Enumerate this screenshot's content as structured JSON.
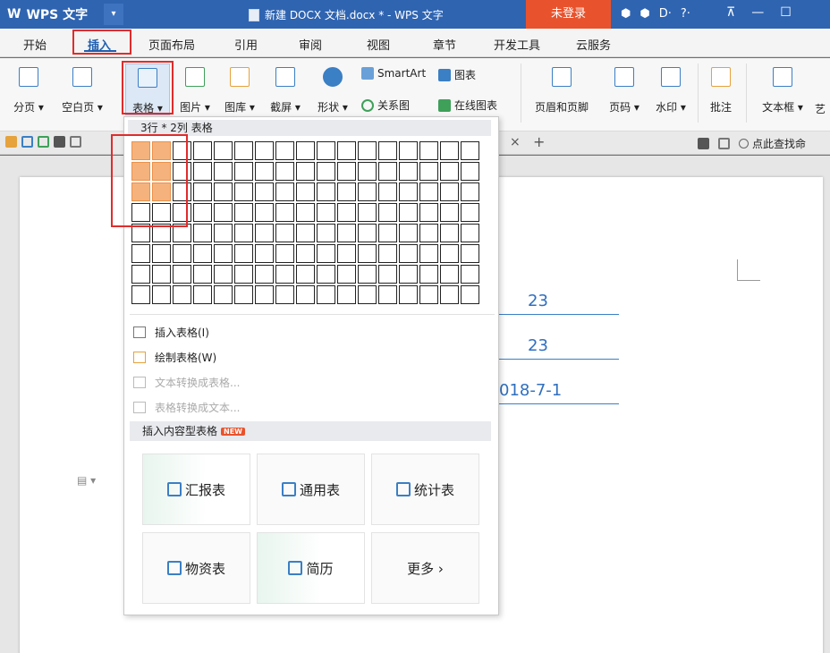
{
  "titlebar": {
    "app_logo": "W",
    "app_name": "WPS 文字",
    "app_arrow": "▾",
    "doc_title": "新建 DOCX 文档.docx * - WPS 文字",
    "login": "未登录",
    "tools": [
      "⬢",
      "⬢",
      "D·",
      "?·"
    ],
    "window_controls": [
      "⊼",
      "—",
      "☐"
    ]
  },
  "menu": {
    "tabs": [
      "开始",
      "插入",
      "页面布局",
      "引用",
      "审阅",
      "视图",
      "章节",
      "开发工具",
      "云服务"
    ]
  },
  "ribbon": {
    "page_break": "分页",
    "blank_page": "空白页",
    "table": "表格",
    "picture": "图片",
    "gallery": "图库",
    "screenshot": "截屏",
    "shape": "形状",
    "smartart": "SmartArt",
    "chart": "图表",
    "relation": "关系图",
    "online_chart": "在线图表",
    "header_footer": "页眉和页脚",
    "page_number": "页码",
    "watermark": "水印",
    "comment": "批注",
    "textbox": "文本框",
    "art": "艺",
    "arrow": "▾"
  },
  "quickbar": {
    "tab_close": "×",
    "tab_add": "+",
    "search": "点此查找命"
  },
  "document": {
    "field1": "23",
    "field2": "23",
    "field3": "018-7-1"
  },
  "dropdown": {
    "header": "3行 * 2列 表格",
    "grid_rows": 8,
    "grid_cols": 17,
    "selected_rows": 3,
    "selected_cols": 2,
    "items": [
      {
        "label": "插入表格(I)",
        "enabled": true
      },
      {
        "label": "绘制表格(W)",
        "enabled": true
      },
      {
        "label": "文本转换成表格...",
        "enabled": false
      },
      {
        "label": "表格转换成文本...",
        "enabled": false
      }
    ],
    "section": "插入内容型表格",
    "badge": "NEW",
    "cards": [
      "汇报表",
      "通用表",
      "统计表",
      "物资表",
      "简历",
      "更多 ›"
    ]
  }
}
